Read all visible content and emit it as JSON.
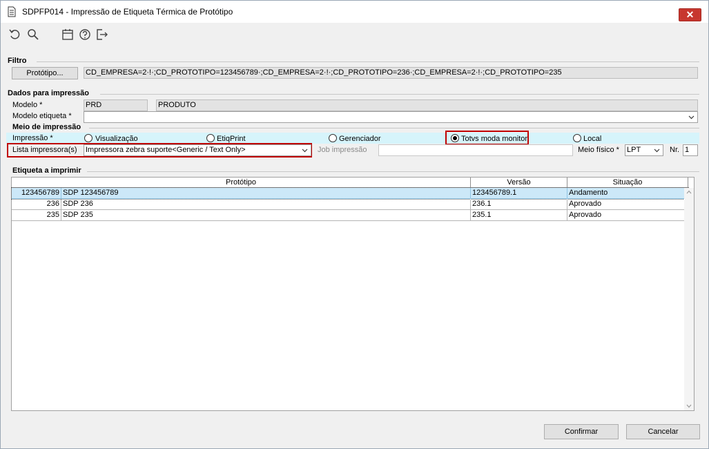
{
  "window": {
    "title": "SDPFP014 - Impressão de Etiqueta Térmica de Protótipo",
    "close_glyph": "✕"
  },
  "toolbar": {
    "icons": [
      "refresh-icon",
      "search-icon",
      "calendar-icon",
      "help-icon",
      "exit-icon"
    ]
  },
  "filtro": {
    "label": "Filtro",
    "prototipo_button": "Protótipo...",
    "value": "CD_EMPRESA=2·!·;CD_PROTOTIPO=123456789·;CD_EMPRESA=2·!·;CD_PROTOTIPO=236·;CD_EMPRESA=2·!·;CD_PROTOTIPO=235"
  },
  "dados": {
    "label": "Dados para impressão",
    "modelo_label": "Modelo *",
    "modelo_code": "PRD",
    "modelo_desc": "PRODUTO",
    "modelo_etiqueta_label": "Modelo etiqueta *",
    "modelo_etiqueta_value": ""
  },
  "meio": {
    "label": "Meio de impressão",
    "impressao_label": "Impressão *",
    "options": [
      {
        "label": "Visualização",
        "selected": false
      },
      {
        "label": "EtiqPrint",
        "selected": false
      },
      {
        "label": "Gerenciador",
        "selected": false
      },
      {
        "label": "Totvs moda monitor",
        "selected": true
      },
      {
        "label": "Local",
        "selected": false
      }
    ],
    "lista_label": "Lista impressora(s)",
    "lista_value": "Impressora zebra suporte<Generic / Text Only>",
    "job_label": "Job impressão",
    "job_value": "",
    "meio_fisico_label": "Meio físico *",
    "meio_fisico_value": "LPT",
    "nr_label": "Nr.",
    "nr_value": "1"
  },
  "etiqueta": {
    "label": "Etiqueta a imprimir",
    "columns": [
      "Protótipo",
      "Versão",
      "Situação"
    ],
    "rows": [
      {
        "code": "123456789",
        "name": "SDP 123456789",
        "versao": "123456789.1",
        "situacao": "Andamento"
      },
      {
        "code": "236",
        "name": "SDP 236",
        "versao": "236.1",
        "situacao": "Aprovado"
      },
      {
        "code": "235",
        "name": "SDP 235",
        "versao": "235.1",
        "situacao": "Aprovado"
      }
    ]
  },
  "footer": {
    "confirmar": "Confirmar",
    "cancelar": "Cancelar"
  }
}
